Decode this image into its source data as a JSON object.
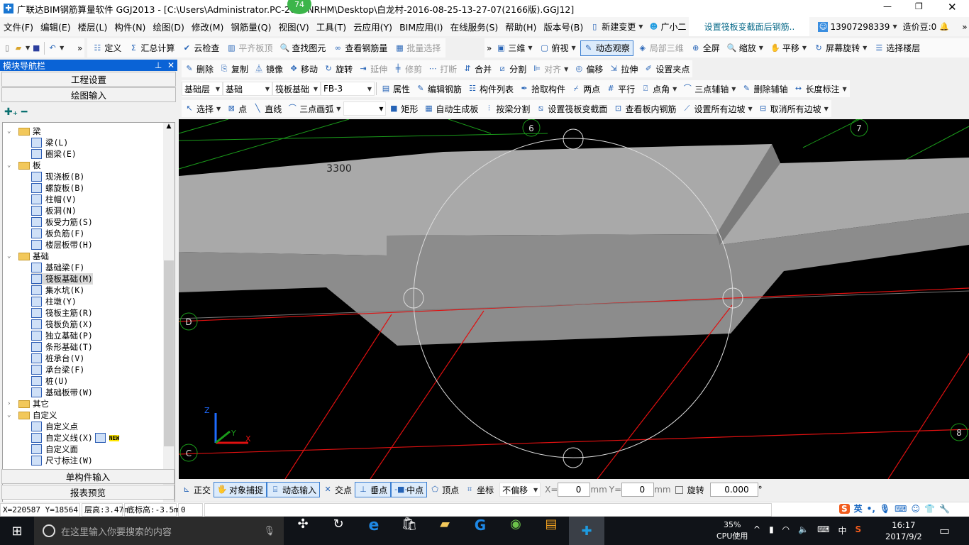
{
  "window": {
    "title": "广联达BIM钢筋算量软件 GGJ2013 - [C:\\Users\\Administrator.PC-201-    NRHM\\Desktop\\白龙村-2016-08-25-13-27-07(2166版).GGJ12]",
    "badge": "74"
  },
  "menu": [
    "文件(F)",
    "编辑(E)",
    "楼层(L)",
    "构件(N)",
    "绘图(D)",
    "修改(M)",
    "钢筋量(Q)",
    "视图(V)",
    "工具(T)",
    "云应用(Y)",
    "BIM应用(I)",
    "在线服务(S)",
    "帮助(H)",
    "版本号(B)"
  ],
  "menu_extra": {
    "new_change": "新建变更",
    "assistant": "广小二",
    "notice": "设置筏板变截面后钢筋..",
    "phone": "13907298339",
    "beans": "造价豆:0"
  },
  "toolbar1": [
    "定义",
    "汇总计算",
    "云检查",
    "平齐板顶",
    "查找图元",
    "查看钢筋量",
    "批量选择"
  ],
  "toolbar1_right": [
    "三维",
    "俯视",
    "动态观察",
    "局部三维",
    "全屏",
    "缩放",
    "平移",
    "屏幕旋转",
    "选择楼层"
  ],
  "toolbar2": [
    "删除",
    "复制",
    "镜像",
    "移动",
    "旋转",
    "延伸",
    "修剪",
    "打断",
    "合并",
    "分割",
    "对齐",
    "偏移",
    "拉伸",
    "设置夹点"
  ],
  "selectors": [
    "基础层",
    "基础",
    "筏板基础",
    "FB-3"
  ],
  "toolbar3": [
    "属性",
    "编辑钢筋",
    "构件列表",
    "拾取构件",
    "两点",
    "平行",
    "点角",
    "三点辅轴",
    "删除辅轴",
    "长度标注"
  ],
  "toolbar4": [
    "选择",
    "点",
    "直线",
    "三点画弧",
    "矩形",
    "自动生成板",
    "按梁分割",
    "设置筏板变截面",
    "查看板内钢筋",
    "设置所有边坡",
    "取消所有边坡"
  ],
  "nav": {
    "title": "模块导航栏",
    "top_buttons": [
      "工程设置",
      "绘图输入"
    ],
    "bottom_buttons": [
      "单构件输入",
      "报表预览"
    ],
    "tree": [
      {
        "label": "梁",
        "type": "folder",
        "open": true
      },
      {
        "label": "梁(L)"
      },
      {
        "label": "圈梁(E)"
      },
      {
        "label": "板",
        "type": "folder",
        "open": true
      },
      {
        "label": "现浇板(B)"
      },
      {
        "label": "螺旋板(B)"
      },
      {
        "label": "柱帽(V)"
      },
      {
        "label": "板洞(N)"
      },
      {
        "label": "板受力筋(S)"
      },
      {
        "label": "板负筋(F)"
      },
      {
        "label": "楼层板带(H)"
      },
      {
        "label": "基础",
        "type": "folder",
        "open": true
      },
      {
        "label": "基础梁(F)"
      },
      {
        "label": "筏板基础(M)",
        "selected": true
      },
      {
        "label": "集水坑(K)"
      },
      {
        "label": "柱墩(Y)"
      },
      {
        "label": "筏板主筋(R)"
      },
      {
        "label": "筏板负筋(X)"
      },
      {
        "label": "独立基础(P)"
      },
      {
        "label": "条形基础(T)"
      },
      {
        "label": "桩承台(V)"
      },
      {
        "label": "承台梁(F)"
      },
      {
        "label": "桩(U)"
      },
      {
        "label": "基础板带(W)"
      },
      {
        "label": "其它",
        "type": "folder",
        "open": false
      },
      {
        "label": "自定义",
        "type": "folder",
        "open": true
      },
      {
        "label": "自定义点"
      },
      {
        "label": "自定义线(X)",
        "new": "NEW"
      },
      {
        "label": "自定义面"
      },
      {
        "label": "尺寸标注(W)"
      }
    ]
  },
  "viewport": {
    "axis_labels": [
      "6",
      "7",
      "D",
      "C",
      "8"
    ],
    "dimension": "3300",
    "axes": [
      "Z",
      "Y",
      "X"
    ],
    "colors": {
      "slab_top": "#a9a9a9",
      "slab_front": "#8c8c8c",
      "grid_red": "#e01010",
      "grid_green": "#1a9a1a"
    }
  },
  "snapbar": {
    "buttons": [
      "正交",
      "对象捕捉",
      "动态输入",
      "交点",
      "垂点",
      "中点",
      "顶点",
      "坐标"
    ],
    "offset": "不偏移",
    "x_label": "X=",
    "x_value": "0",
    "y_label": "Y=",
    "y_value": "0",
    "unit": "mm",
    "rotate_label": "旋转",
    "rotate_value": "0.000",
    "degree": "°"
  },
  "status": {
    "coords": "X=220587 Y=18564",
    "floor_height": "层高:3.47m",
    "base_elev": "底标高:-3.5m",
    "value": "0",
    "ime": "英"
  },
  "taskbar": {
    "search_placeholder": "在这里输入你要搜索的内容",
    "cpu": "35%",
    "cpu_label": "CPU使用",
    "lang": "中",
    "time": "16:17",
    "date": "2017/9/2"
  }
}
